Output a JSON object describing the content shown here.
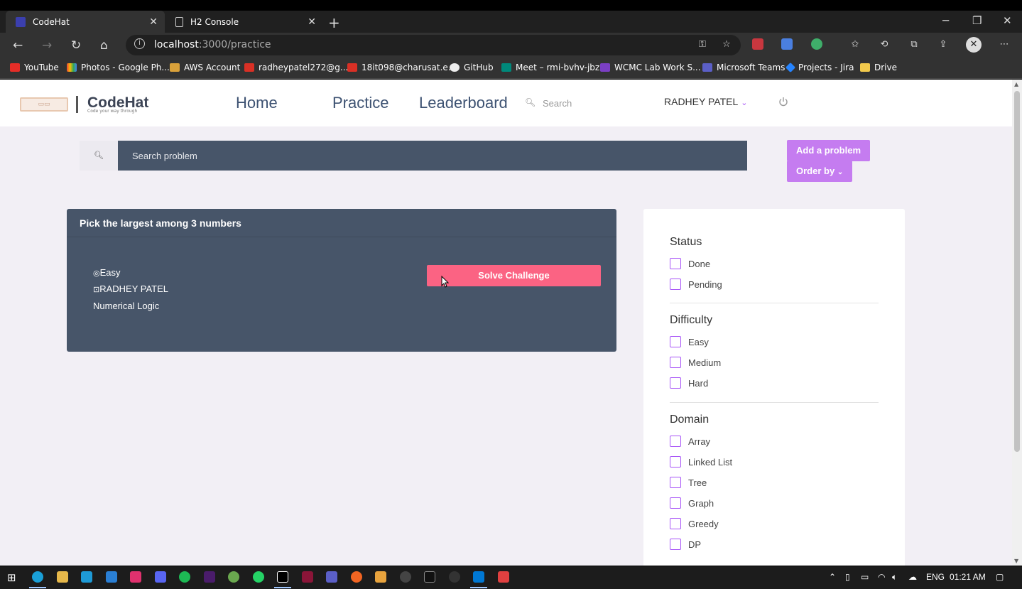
{
  "browser": {
    "tabs": [
      {
        "title": "CodeHat",
        "active": true
      },
      {
        "title": "H2 Console",
        "active": false
      }
    ],
    "url_host": "localhost",
    "url_path": ":3000/practice",
    "bookmarks": [
      "YouTube",
      "Photos - Google Ph...",
      "AWS Account",
      "radheypatel272@g...",
      "18it098@charusat.e...",
      "GitHub",
      "Meet – rmi-bvhv-jbz",
      "WCMC Lab Work S...",
      "Microsoft Teams",
      "Projects - Jira",
      "Drive"
    ]
  },
  "header": {
    "logo_text": "CodeHat",
    "logo_subtitle": "Code your way through",
    "nav": [
      "Home",
      "Practice",
      "Leaderboard"
    ],
    "search_placeholder": "Search",
    "user_name": "RADHEY PATEL"
  },
  "toolbar": {
    "search_placeholder": "Search problem",
    "add_problem_label": "Add a problem",
    "order_by_label": "Order by"
  },
  "problem": {
    "title": "Pick the largest among 3 numbers",
    "difficulty": "Easy",
    "author": "RADHEY PATEL",
    "domain": "Numerical Logic",
    "solve_label": "Solve Challenge"
  },
  "filters": {
    "status": {
      "title": "Status",
      "options": [
        "Done",
        "Pending"
      ]
    },
    "difficulty": {
      "title": "Difficulty",
      "options": [
        "Easy",
        "Medium",
        "Hard"
      ]
    },
    "domain": {
      "title": "Domain",
      "options": [
        "Array",
        "Linked List",
        "Tree",
        "Graph",
        "Greedy",
        "DP"
      ]
    }
  },
  "taskbar": {
    "language": "ENG",
    "time": "01:21 AM"
  }
}
